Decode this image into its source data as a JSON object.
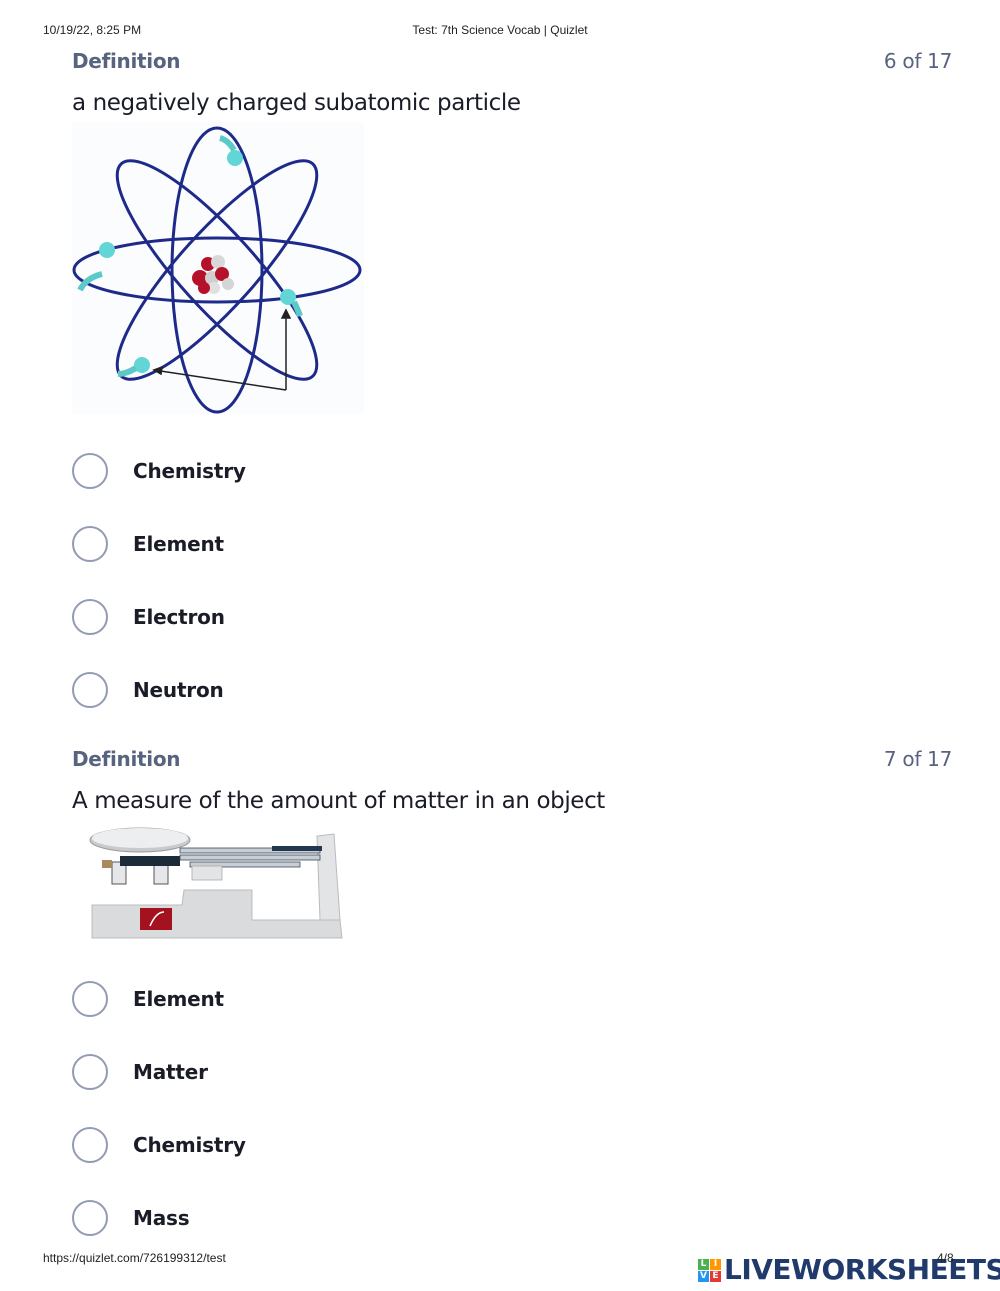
{
  "print_header": {
    "datetime": "10/19/22, 8:25 PM",
    "title": "Test: 7th Science Vocab | Quizlet"
  },
  "questions": [
    {
      "label": "Definition",
      "counter": "6 of 17",
      "prompt": "a negatively charged subatomic particle",
      "image": "atom-diagram",
      "options": [
        "Chemistry",
        "Element",
        "Electron",
        "Neutron"
      ]
    },
    {
      "label": "Definition",
      "counter": "7 of 17",
      "prompt": "A measure of the amount of matter in an object",
      "image": "triple-beam-balance",
      "options": [
        "Element",
        "Matter",
        "Chemistry",
        "Mass"
      ]
    }
  ],
  "print_footer": {
    "url": "https://quizlet.com/726199312/test",
    "page": "4/8"
  },
  "watermark": {
    "blocks": [
      "L",
      "I",
      "V",
      "E"
    ],
    "block_colors": [
      "#4caf50",
      "#ff9800",
      "#2196f3",
      "#e53935"
    ],
    "text": "LIVEWORKSHEETS",
    "color": "#1f3a6b"
  },
  "colors": {
    "label_gray": "#586380",
    "radio_border": "#939bb4",
    "text_dark": "#1a1d28"
  }
}
